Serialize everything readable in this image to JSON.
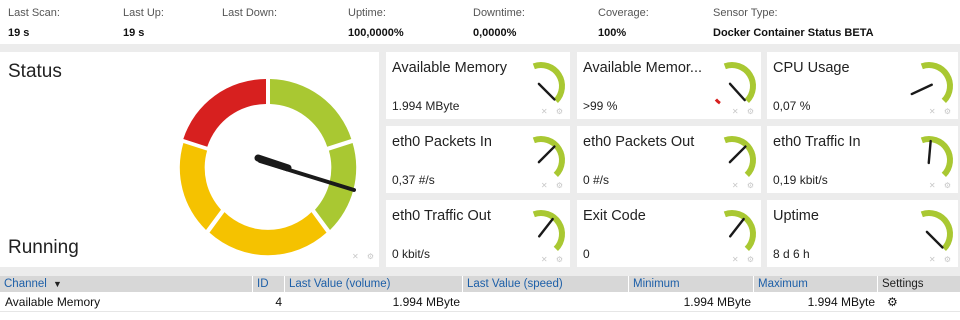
{
  "header": {
    "last_scan": {
      "label": "Last Scan:",
      "value": "19 s"
    },
    "last_up": {
      "label": "Last Up:",
      "value": "19 s"
    },
    "last_down": {
      "label": "Last Down:",
      "value": ""
    },
    "uptime": {
      "label": "Uptime:",
      "value": "100,0000%"
    },
    "downtime": {
      "label": "Downtime:",
      "value": "0,0000%"
    },
    "coverage": {
      "label": "Coverage:",
      "value": "100%"
    },
    "sensor_type": {
      "label": "Sensor Type:",
      "value": "Docker Container Status BETA"
    }
  },
  "status": {
    "title": "Status",
    "value": "Running"
  },
  "tiles": [
    {
      "title": "Available Memory",
      "value": "1.994 MByte"
    },
    {
      "title": "Available Memor...",
      "value": ">99 %"
    },
    {
      "title": "CPU Usage",
      "value": "0,07 %"
    },
    {
      "title": "eth0 Packets In",
      "value": "0,37 #/s"
    },
    {
      "title": "eth0 Packets Out",
      "value": "0 #/s"
    },
    {
      "title": "eth0 Traffic In",
      "value": "0,19 kbit/s"
    },
    {
      "title": "eth0 Traffic Out",
      "value": "0 kbit/s"
    },
    {
      "title": "Exit Code",
      "value": "0"
    },
    {
      "title": "Uptime",
      "value": "8 d 6 h"
    }
  ],
  "table": {
    "headers": {
      "channel": "Channel",
      "sort_arrow": "▼",
      "id": "ID",
      "last_value_volume": "Last Value (volume)",
      "last_value_speed": "Last Value (speed)",
      "minimum": "Minimum",
      "maximum": "Maximum",
      "settings": "Settings"
    },
    "rows": [
      {
        "channel": "Available Memory",
        "id": "4",
        "volume": "1.994 MByte",
        "speed": "",
        "minimum": "1.994 MByte",
        "maximum": "1.994 MByte",
        "settings_icon": "gear-icon"
      }
    ]
  },
  "colors": {
    "gauge_green": "#a9c832",
    "gauge_yellow": "#f5c200",
    "gauge_red": "#d7201f",
    "header_link": "#1d5fa8"
  }
}
